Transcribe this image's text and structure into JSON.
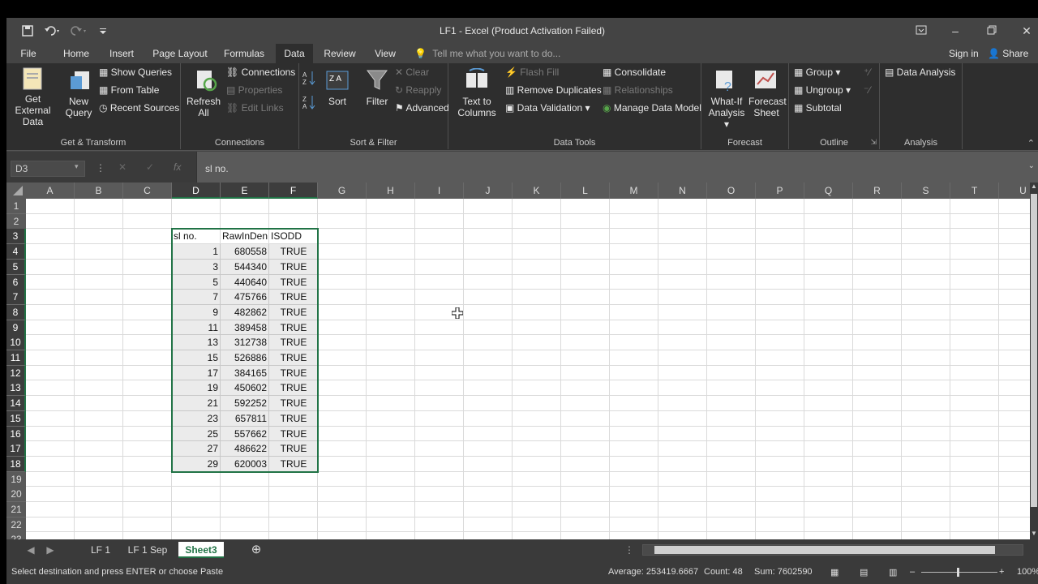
{
  "title": "LF1 - Excel (Product Activation Failed)",
  "tabs": [
    "File",
    "Home",
    "Insert",
    "Page Layout",
    "Formulas",
    "Data",
    "Review",
    "View"
  ],
  "active_tab": "Data",
  "tellme": "Tell me what you want to do...",
  "signin": "Sign in",
  "share": "Share",
  "ribbon": {
    "get_external_data": "Get External",
    "get_external_data2": "Data",
    "new_query": "New",
    "new_query2": "Query",
    "show_queries": "Show Queries",
    "from_table": "From Table",
    "recent_sources": "Recent Sources",
    "grp_get_transform": "Get & Transform",
    "refresh": "Refresh",
    "refresh2": "All",
    "connections": "Connections",
    "properties": "Properties",
    "edit_links": "Edit Links",
    "grp_connections": "Connections",
    "sort": "Sort",
    "filter": "Filter",
    "clear": "Clear",
    "reapply": "Reapply",
    "advanced": "Advanced",
    "grp_sort_filter": "Sort & Filter",
    "text_to_columns": "Text to",
    "text_to_columns2": "Columns",
    "flash_fill": "Flash Fill",
    "remove_duplicates": "Remove Duplicates",
    "data_validation": "Data Validation",
    "consolidate": "Consolidate",
    "relationships": "Relationships",
    "manage_data_model": "Manage Data Model",
    "grp_data_tools": "Data Tools",
    "what_if": "What-If",
    "what_if2": "Analysis",
    "forecast_sheet": "Forecast",
    "forecast_sheet2": "Sheet",
    "grp_forecast": "Forecast",
    "group": "Group",
    "ungroup": "Ungroup",
    "subtotal": "Subtotal",
    "grp_outline": "Outline",
    "data_analysis": "Data Analysis",
    "grp_analysis": "Analysis"
  },
  "formula_bar": {
    "name_box": "D3",
    "formula": "sl no."
  },
  "columns": [
    "A",
    "B",
    "C",
    "D",
    "E",
    "F",
    "G",
    "H",
    "I",
    "J",
    "K",
    "L",
    "M",
    "N",
    "O",
    "P",
    "Q",
    "R",
    "S",
    "T",
    "U"
  ],
  "rows": [
    "1",
    "2",
    "3",
    "4",
    "5",
    "6",
    "7",
    "8",
    "9",
    "10",
    "11",
    "12",
    "13",
    "14",
    "15",
    "16",
    "17",
    "18",
    "19",
    "20",
    "21",
    "22",
    "23"
  ],
  "table": {
    "headers": [
      "sl no.",
      "RawInDen",
      "ISODD"
    ],
    "rows": [
      [
        "1",
        "680558",
        "TRUE"
      ],
      [
        "3",
        "544340",
        "TRUE"
      ],
      [
        "5",
        "440640",
        "TRUE"
      ],
      [
        "7",
        "475766",
        "TRUE"
      ],
      [
        "9",
        "482862",
        "TRUE"
      ],
      [
        "11",
        "389458",
        "TRUE"
      ],
      [
        "13",
        "312738",
        "TRUE"
      ],
      [
        "15",
        "526886",
        "TRUE"
      ],
      [
        "17",
        "384165",
        "TRUE"
      ],
      [
        "19",
        "450602",
        "TRUE"
      ],
      [
        "21",
        "592252",
        "TRUE"
      ],
      [
        "23",
        "657811",
        "TRUE"
      ],
      [
        "25",
        "557662",
        "TRUE"
      ],
      [
        "27",
        "486622",
        "TRUE"
      ],
      [
        "29",
        "620003",
        "TRUE"
      ]
    ]
  },
  "sheets": [
    "LF 1",
    "LF 1 Sep",
    "Sheet3"
  ],
  "active_sheet": "Sheet3",
  "status": {
    "message": "Select destination and press ENTER or choose Paste",
    "average": "Average: 253419.6667",
    "count": "Count: 48",
    "sum": "Sum: 7602590",
    "zoom": "100%"
  },
  "colors": {
    "accent": "#217346",
    "ribbon_bg": "#2e2e2e",
    "title_bg": "#444444"
  }
}
